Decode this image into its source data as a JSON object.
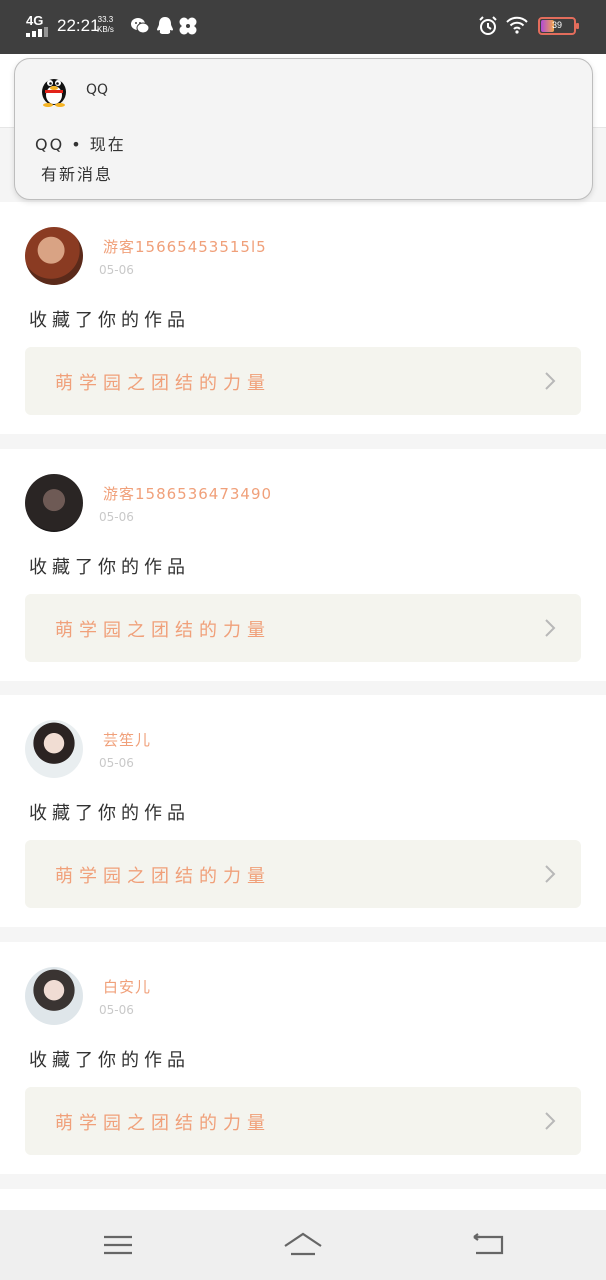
{
  "status_bar": {
    "network": "4G",
    "time": "22:21",
    "speed_value": "33.3",
    "speed_unit": "KB/s",
    "battery_level": "39",
    "icons": [
      "wechat-icon",
      "qq-icon",
      "pinwheel-icon",
      "alarm-icon",
      "wifi-icon",
      "battery-icon"
    ]
  },
  "notification": {
    "app_name": "QQ",
    "line1": "QQ • 现在",
    "line2": "有新消息",
    "icon": "qq-penguin-icon"
  },
  "feed": [
    {
      "user": "游客15665453515l5",
      "date": "05-06",
      "action": "收藏了你的作品",
      "work_title": "萌学园之团结的力量"
    },
    {
      "user": "游客1586536473490",
      "date": "05-06",
      "action": "收藏了你的作品",
      "work_title": "萌学园之团结的力量"
    },
    {
      "user": "芸笙儿",
      "date": "05-06",
      "action": "收藏了你的作品",
      "work_title": "萌学园之团结的力量"
    },
    {
      "user": "白安儿",
      "date": "05-06",
      "action": "收藏了你的作品",
      "work_title": "萌学园之团结的力量"
    }
  ],
  "colors": {
    "accent": "#f0a07a",
    "work_bg": "#f4f4ee",
    "status_bar": "#3f3f3f"
  },
  "nav_bar": {
    "icons": [
      "menu-icon",
      "home-icon",
      "back-icon"
    ]
  }
}
